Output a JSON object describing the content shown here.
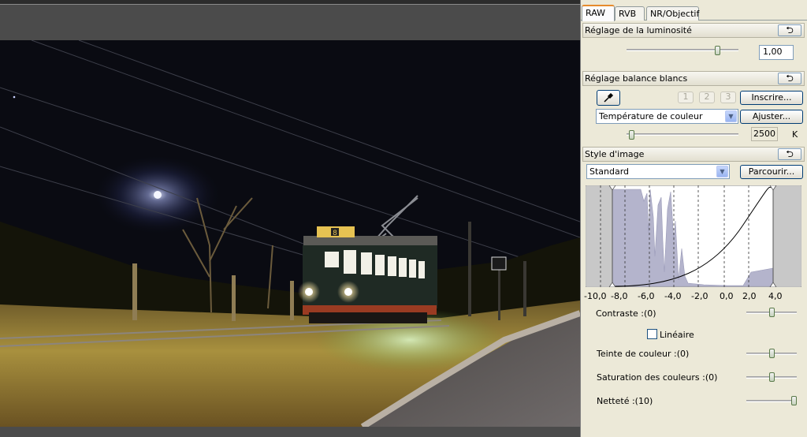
{
  "tabs": [
    "RAW",
    "RVB",
    "NR/Objectif"
  ],
  "brightness": {
    "title": "Réglage de la luminosité",
    "reset_icon": "undo-arrow",
    "value": "1,00",
    "slider_level": 0.83
  },
  "white_balance": {
    "title": "Réglage balance blancs",
    "reset_icon": "undo-arrow",
    "eyedropper_icon": "eyedropper",
    "preset_slots": [
      "1",
      "2",
      "3"
    ],
    "register_label": "Inscrire...",
    "mode_value": "Température de couleur",
    "adjust_label": "Ajuster...",
    "temperature": "2500",
    "temperature_unit": "K",
    "slider_level": 0.02
  },
  "picture_style": {
    "title": "Style d'image",
    "reset_icon": "undo-arrow",
    "style_value": "Standard",
    "browse_label": "Parcourir..."
  },
  "histogram_axis": [
    "-10,0",
    "-8,0",
    "-6,0",
    "-4,0",
    "-2,0",
    "0,0",
    "2,0",
    "4,0"
  ],
  "adjustments": {
    "contrast_label": "Contraste :(0)",
    "linear_label": "Linéaire",
    "linear_checked": false,
    "tint_label": "Teinte de couleur :(0)",
    "saturation_label": "Saturation des couleurs :(0)",
    "sharpness_label": "Netteté :(10)",
    "contrast_level": 0.5,
    "tint_level": 0.5,
    "saturation_level": 0.5,
    "sharpness_level": 1.0
  },
  "photo": {
    "tram_sign": "8"
  },
  "colors": {
    "tab_accent": "#e68b2c",
    "panel_bg": "#ece9d8",
    "histogram_fill": "#b4b4cc"
  }
}
